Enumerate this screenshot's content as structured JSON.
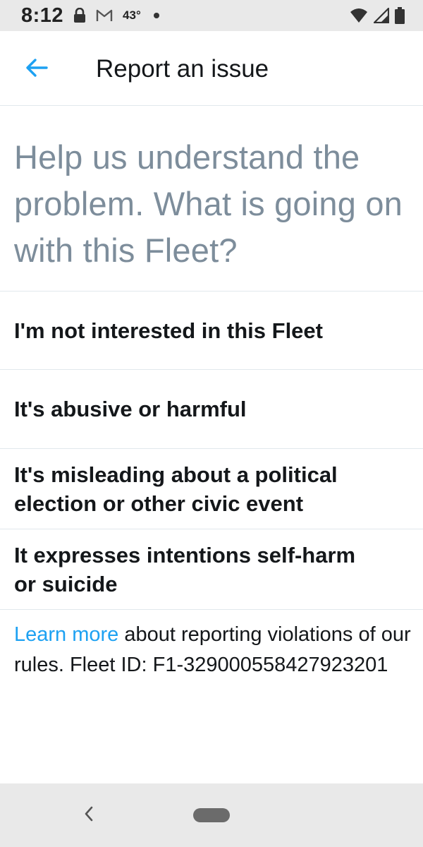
{
  "status_bar": {
    "time": "8:12",
    "temperature": "43°",
    "icons": [
      "lock-icon",
      "gmail-icon",
      "notification-dot-icon",
      "wifi-icon",
      "signal-icon",
      "battery-icon"
    ]
  },
  "app_bar": {
    "title": "Report an issue",
    "back_icon": "arrow-left-icon",
    "accent_color": "#1da1f2"
  },
  "prompt": {
    "text": "Help us understand the problem. What is going on with this Fleet?"
  },
  "options": [
    {
      "label": "I'm not interested in this Fleet"
    },
    {
      "label": "It's abusive or harmful"
    },
    {
      "label": "It's misleading about a political election or other civic event"
    },
    {
      "label": "It expresses intentions self-harm or suicide"
    }
  ],
  "footer": {
    "link_text": "Learn more",
    "text": " about reporting violations of our rules. Fleet ID: F1-329000558427923201"
  },
  "nav_bar": {
    "icons": [
      "nav-back-icon",
      "home-pill-icon"
    ]
  }
}
